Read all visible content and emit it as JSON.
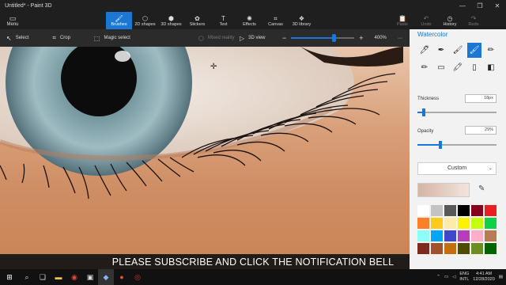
{
  "window": {
    "title": "Untitled* - Paint 3D",
    "controls": [
      "—",
      "❐",
      "✕"
    ]
  },
  "ribbon": {
    "menu_label": "Menu",
    "tools": [
      {
        "label": "Brushes",
        "icon": "brush-icon",
        "glyph": "🖌"
      },
      {
        "label": "2D shapes",
        "icon": "2d-shapes-icon",
        "glyph": "⬡"
      },
      {
        "label": "3D shapes",
        "icon": "3d-shapes-icon",
        "glyph": "⬢"
      },
      {
        "label": "Stickers",
        "icon": "stickers-icon",
        "glyph": "✿"
      },
      {
        "label": "Text",
        "icon": "text-icon",
        "glyph": "T"
      },
      {
        "label": "Effects",
        "icon": "effects-icon",
        "glyph": "✺"
      },
      {
        "label": "Canvas",
        "icon": "canvas-icon",
        "glyph": "⌗"
      },
      {
        "label": "3D library",
        "icon": "3d-library-icon",
        "glyph": "❖"
      }
    ],
    "right_tools": [
      {
        "label": "Paste",
        "glyph": "📋"
      },
      {
        "label": "Undo",
        "glyph": "↶"
      },
      {
        "label": "History",
        "glyph": "◷"
      },
      {
        "label": "Redo",
        "glyph": "↷"
      }
    ]
  },
  "subtoolbar": {
    "select": "Select",
    "crop": "Crop",
    "magic_select": "Magic select",
    "mixed_reality": "Mixed reality",
    "view_3d": "3D view",
    "zoom": "400%",
    "zoom_level": 0.67
  },
  "caption": "PLEASE SUBSCRIBE AND CLICK THE NOTIFICATION BELL",
  "panel": {
    "title": "Watercolor",
    "thickness_label": "Thickness",
    "thickness_value": "18px",
    "thickness_level": 0.08,
    "opacity_label": "Opacity",
    "opacity_value": "29%",
    "opacity_level": 0.29,
    "color_mode": "Custom",
    "swatches": [
      "#ffffff",
      "#c3c3c3",
      "#585858",
      "#000000",
      "#88001b",
      "#ec1c24",
      "#ff7f27",
      "#ffca18",
      "#fdeca6",
      "#fff200",
      "#c4ff0e",
      "#0ed145",
      "#8cfffb",
      "#00a8f3",
      "#3f48cc",
      "#b83dba",
      "#ffaec8",
      "#b97a56",
      "#7f2a1d",
      "#a0522d",
      "#c36f0f",
      "#4d4d00",
      "#6b8e23",
      "#006400"
    ]
  },
  "taskbar": {
    "lang_top": "ENG",
    "lang_bottom": "INTL",
    "time": "4:41 AM",
    "date": "12/28/2020"
  }
}
